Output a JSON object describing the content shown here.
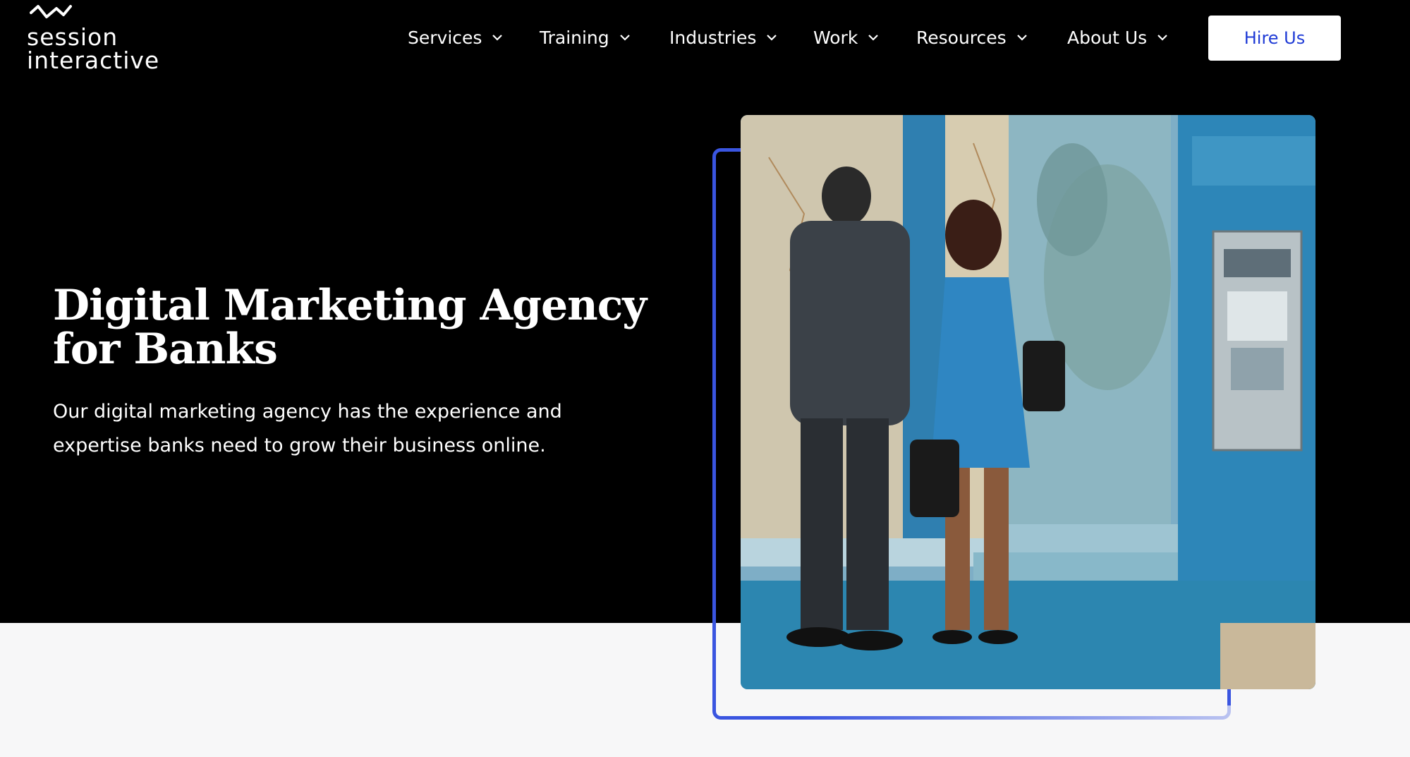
{
  "brand": {
    "logo_line1": "session",
    "logo_line2": "interactive",
    "accent": "#1f3bd6",
    "frame_color": "#3a55e0"
  },
  "nav": {
    "items": [
      {
        "label": "Services"
      },
      {
        "label": "Training"
      },
      {
        "label": "Industries"
      },
      {
        "label": "Work"
      },
      {
        "label": "Resources"
      },
      {
        "label": "About Us"
      }
    ],
    "cta": "Hire Us"
  },
  "hero": {
    "title": "Digital Marketing Agency for Banks",
    "subtitle": "Our digital marketing agency has the experience and expertise banks need to grow their business online.",
    "image_icon": "bank-atm-illustration"
  }
}
